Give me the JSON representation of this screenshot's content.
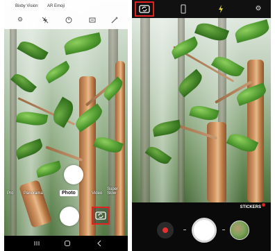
{
  "left_screen": {
    "top_labels": [
      "Bixby Vision",
      "AR Emoji"
    ],
    "top_icons": [
      "gear-icon",
      "flash-off-icon",
      "timer-icon",
      "aspect-ratio-icon",
      "magic-wand-icon"
    ],
    "modes": [
      "Pro",
      "Panorama",
      "Photo",
      "Video",
      "Super Slow"
    ],
    "active_mode": "Photo",
    "switch_camera_highlighted": true,
    "nav_icons": [
      "recent-apps-icon",
      "home-icon",
      "back-icon"
    ]
  },
  "right_screen": {
    "top_icons": [
      "switch-camera-icon",
      "aspect-ratio-icon",
      "flash-icon",
      "gear-icon"
    ],
    "switch_camera_highlighted": true,
    "stickers_label": "STICKERS",
    "bottom_controls": [
      "record-button",
      "shutter-button",
      "gallery-thumbnail"
    ]
  },
  "colors": {
    "highlight": "#e62121",
    "flash_icon": "#e6d43a",
    "record_dot": "#e63030"
  }
}
